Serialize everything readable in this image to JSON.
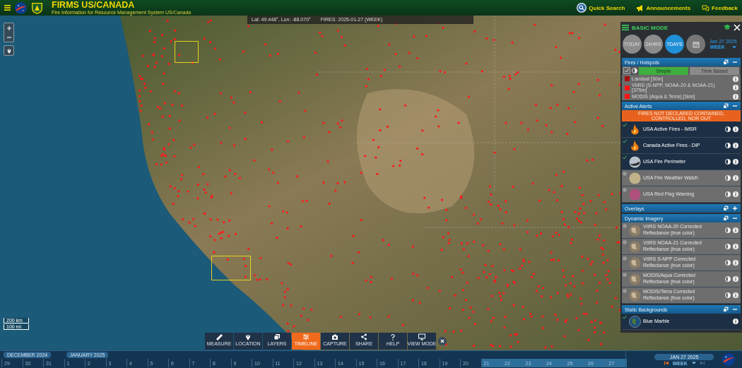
{
  "header": {
    "title": "FIRMS US/CANADA",
    "subtitle": "Fire Information for Resource Management System US/Canada",
    "links": [
      {
        "kind": "search",
        "label": "Quick Search"
      },
      {
        "kind": "announce",
        "label": "Announcements"
      },
      {
        "kind": "feedback",
        "label": "Feedback"
      }
    ]
  },
  "coordinates": {
    "position": "Lat: 49.448°, Lon: -88.070°",
    "fires": "FIRES: 2025-01-27 (WEEK)"
  },
  "map": {
    "scale": [
      "200 km",
      "100 mi"
    ]
  },
  "panel": {
    "mode": "BASIC MODE",
    "ranges": [
      {
        "label": "TODAY",
        "selected": false
      },
      {
        "label": "24HRS",
        "selected": false
      },
      {
        "label": "7DAYS",
        "selected": true
      }
    ],
    "date": "Jan 27 2025",
    "period": "WEEK",
    "sections": [
      {
        "kind": "hotspots",
        "title": "Fires / Hotspots",
        "expanded": true,
        "checked": true,
        "tabs": [
          {
            "label": "Simple",
            "selected": true
          },
          {
            "label": "Time Based",
            "selected": false
          }
        ],
        "items": [
          {
            "label": "Landsat [30m]",
            "color": "#a50d0d"
          },
          {
            "label": "VIIRS (S-NPP, NOAA-20 & NOAA-21) [375m]",
            "color": "#ff1414"
          },
          {
            "label": "MODIS (Aqua & Terra) [1km]",
            "color": "#ff1414"
          }
        ]
      },
      {
        "kind": "layers",
        "title": "Active Alerts",
        "expanded": true,
        "banner": "FIRES NOT DECLARED CONTAINED, CONTROLLED, NOR OUT",
        "items": [
          {
            "label": "USA Active Fires - IMSR",
            "checked": true,
            "kind": "flame",
            "adjustable": true
          },
          {
            "label": "Canada Active Fires - DIP",
            "checked": true,
            "kind": "flame",
            "adjustable": true
          },
          {
            "label": "USA Fire Perimeter",
            "checked": true,
            "kind": "perimeter",
            "adjustable": true
          },
          {
            "label": "USA Fire Weather Watch",
            "checked": false,
            "kind": "tan",
            "adjustable": true
          },
          {
            "label": "USA Red Flag Warning",
            "checked": false,
            "kind": "pink",
            "adjustable": true
          }
        ]
      },
      {
        "kind": "layers",
        "title": "Overlays",
        "expanded": false
      },
      {
        "kind": "layers",
        "title": "Dynamic Imagery",
        "expanded": true,
        "items": [
          {
            "label": "VIIRS NOAA-20 Corrected Reflectance (true color)",
            "checked": false,
            "kind": "globe",
            "adjustable": true
          },
          {
            "label": "VIIRS NOAA-21 Corrected Reflectance (true color)",
            "checked": false,
            "kind": "globe",
            "adjustable": true
          },
          {
            "label": "VIIRS S-NPP Corrected Reflectance (true color)",
            "checked": false,
            "kind": "globe",
            "adjustable": true
          },
          {
            "label": "MODIS/Aqua Corrected Reflectance (true color)",
            "checked": false,
            "kind": "globe",
            "adjustable": true
          },
          {
            "label": "MODIS/Terra Corrected Reflectance (true color)",
            "checked": false,
            "kind": "globe",
            "adjustable": true
          }
        ]
      },
      {
        "kind": "layers",
        "title": "Static Backgrounds",
        "expanded": true,
        "items": [
          {
            "label": "Blue Marble",
            "checked": true,
            "kind": "marble",
            "adjustable": false
          }
        ]
      }
    ]
  },
  "toolbar": [
    {
      "kind": "measure",
      "label": "MEASURE",
      "selected": false
    },
    {
      "kind": "location",
      "label": "LOCATION",
      "selected": false
    },
    {
      "kind": "layers",
      "label": "LAYERS",
      "selected": false
    },
    {
      "kind": "timeline",
      "label": "TIMELINE",
      "selected": true
    },
    {
      "kind": "capture",
      "label": "CAPTURE",
      "selected": false
    },
    {
      "kind": "share",
      "label": "SHARE",
      "selected": false
    },
    {
      "kind": "help",
      "label": "HELP",
      "selected": false
    },
    {
      "kind": "viewmode",
      "label": "VIEW MODE",
      "selected": false
    }
  ],
  "timeline": {
    "months": [
      {
        "label": "DECEMBER 2024",
        "days": [
          {
            "label": "29",
            "selected": false
          },
          {
            "label": "30",
            "selected": false
          },
          {
            "label": "31",
            "selected": false
          }
        ]
      },
      {
        "label": "JANUARY 2025",
        "days": [
          {
            "label": "1",
            "selected": false
          },
          {
            "label": "2",
            "selected": false
          },
          {
            "label": "3",
            "selected": false
          },
          {
            "label": "4",
            "selected": false
          },
          {
            "label": "5",
            "selected": false
          },
          {
            "label": "6",
            "selected": false
          },
          {
            "label": "7",
            "selected": false
          },
          {
            "label": "8",
            "selected": false
          },
          {
            "label": "9",
            "selected": false
          },
          {
            "label": "10",
            "selected": false
          },
          {
            "label": "11",
            "selected": false
          },
          {
            "label": "12",
            "selected": false
          },
          {
            "label": "13",
            "selected": false
          },
          {
            "label": "14",
            "selected": false
          },
          {
            "label": "15",
            "selected": false
          },
          {
            "label": "16",
            "selected": false
          },
          {
            "label": "17",
            "selected": false
          },
          {
            "label": "18",
            "selected": false
          },
          {
            "label": "19",
            "selected": false
          },
          {
            "label": "20",
            "selected": false
          },
          {
            "label": "21",
            "selected": true
          },
          {
            "label": "22",
            "selected": true
          },
          {
            "label": "23",
            "selected": true
          },
          {
            "label": "24",
            "selected": true
          },
          {
            "label": "25",
            "selected": true
          },
          {
            "label": "26",
            "selected": true
          },
          {
            "label": "27",
            "selected": true
          }
        ]
      }
    ],
    "date": "JAN 27 2025",
    "period": "WEEK"
  }
}
